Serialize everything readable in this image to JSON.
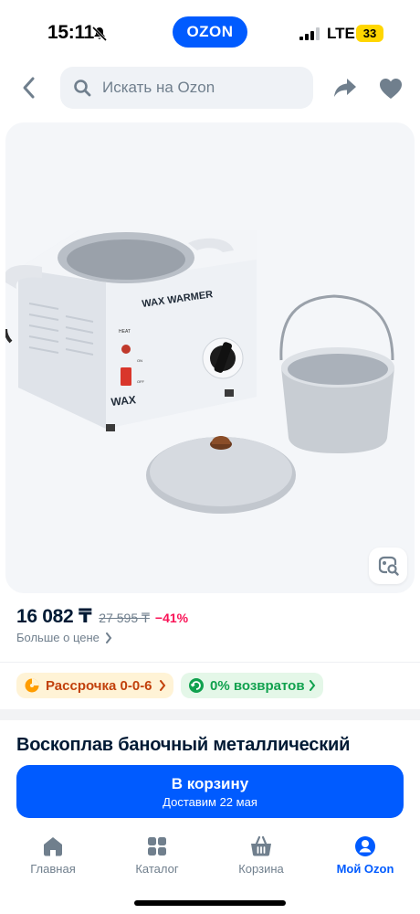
{
  "status_bar": {
    "time": "15:11",
    "network": "LTE",
    "battery": "33",
    "logo": "OZON"
  },
  "header": {
    "search_placeholder": "Искать на Ozon",
    "icons": [
      "chevron-left-icon",
      "search-icon",
      "share-icon",
      "heart-icon"
    ]
  },
  "product_image": {
    "labels": {
      "brand_plate": "WAX WARMER",
      "body_label": "WAX",
      "heat_label": "HEAT",
      "switch_on": "ON",
      "switch_off": "OFF"
    },
    "lens_icon": "image-search-icon"
  },
  "price": {
    "current": "16 082 ₸",
    "old": "27 595 ₸",
    "discount": "−41%",
    "more_label": "Больше о цене"
  },
  "badges": {
    "installment": "Рассрочка 0-0-6",
    "returns": "0% возвратов"
  },
  "product": {
    "title": "Воскоплав баночный металлический"
  },
  "cart": {
    "label": "В корзину",
    "delivery": "Доставим 22 мая"
  },
  "bottom_nav": {
    "items": [
      {
        "label": "Главная",
        "icon": "home-icon"
      },
      {
        "label": "Каталог",
        "icon": "catalog-icon"
      },
      {
        "label": "Корзина",
        "icon": "cart-icon"
      },
      {
        "label": "Мой Ozon",
        "icon": "profile-icon",
        "active": true
      }
    ]
  },
  "colors": {
    "brand_blue": "#005bff",
    "discount_red": "#f91155",
    "installment_orange": "#c2410c",
    "returns_green": "#10a14e"
  }
}
